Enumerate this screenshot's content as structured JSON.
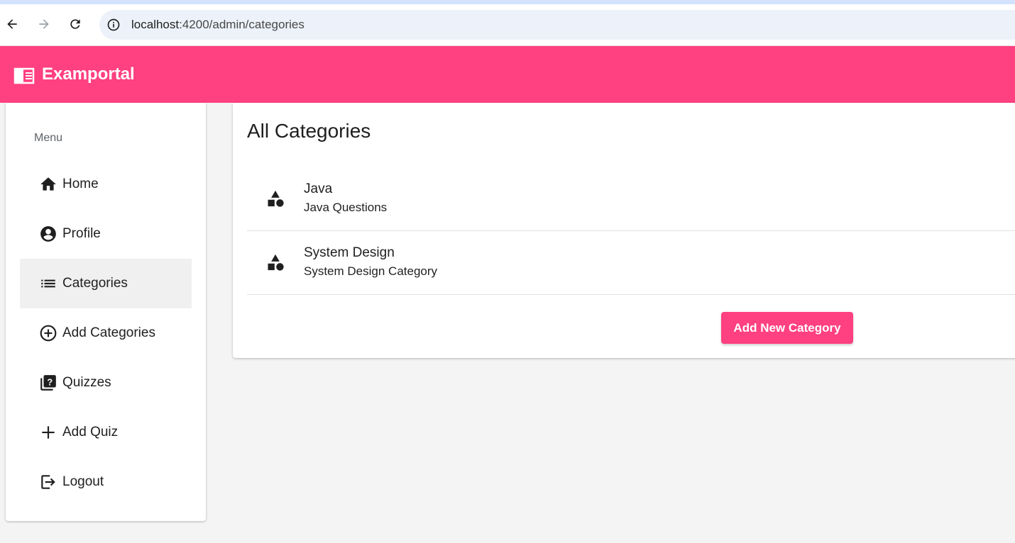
{
  "browser": {
    "url_host": "localhost",
    "url_rest": ":4200/admin/categories"
  },
  "app": {
    "title": "Examportal",
    "brand_icon": "chrome-reader-mode-icon",
    "accent_color": "#ff4081"
  },
  "sidebar": {
    "header": "Menu",
    "items": [
      {
        "label": "Home",
        "icon": "home-icon",
        "active": false
      },
      {
        "label": "Profile",
        "icon": "account-circle-icon",
        "active": false
      },
      {
        "label": "Categories",
        "icon": "list-icon",
        "active": true
      },
      {
        "label": "Add Categories",
        "icon": "add-circle-outline-icon",
        "active": false
      },
      {
        "label": "Quizzes",
        "icon": "quiz-icon",
        "active": false
      },
      {
        "label": "Add Quiz",
        "icon": "add-icon",
        "active": false
      },
      {
        "label": "Logout",
        "icon": "logout-icon",
        "active": false
      }
    ]
  },
  "main": {
    "title": "All Categories",
    "categories": [
      {
        "name": "Java",
        "description": "Java Questions",
        "icon": "category-icon"
      },
      {
        "name": "System Design",
        "description": "System Design Category",
        "icon": "category-icon"
      }
    ],
    "add_button_label": "Add New Category"
  }
}
